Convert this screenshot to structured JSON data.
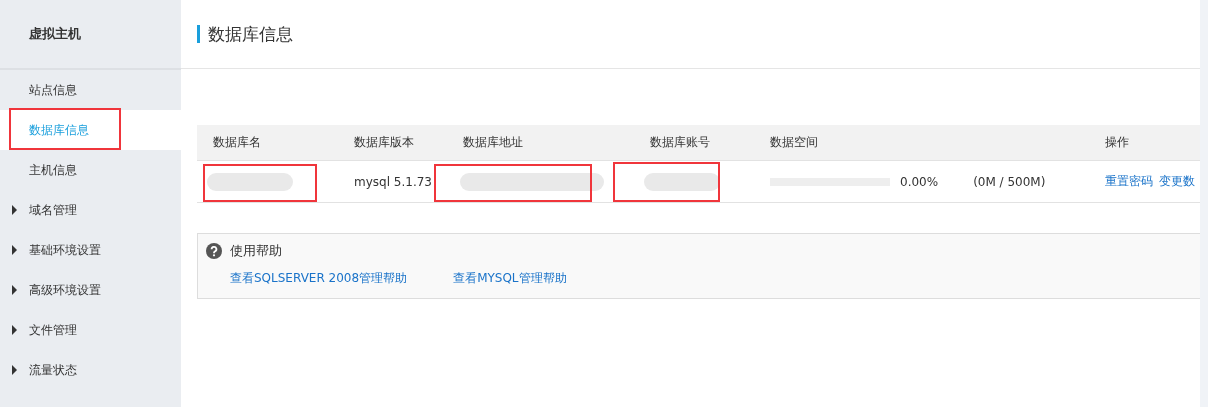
{
  "sidebar": {
    "title": "虚拟主机",
    "items": [
      {
        "label": "站点信息",
        "selected": false,
        "expandable": false,
        "highlighted": false
      },
      {
        "label": "数据库信息",
        "selected": true,
        "expandable": false,
        "highlighted": true
      },
      {
        "label": "主机信息",
        "selected": false,
        "expandable": false,
        "highlighted": false
      },
      {
        "label": "域名管理",
        "selected": false,
        "expandable": true,
        "highlighted": false
      },
      {
        "label": "基础环境设置",
        "selected": false,
        "expandable": true,
        "highlighted": false
      },
      {
        "label": "高级环境设置",
        "selected": false,
        "expandable": true,
        "highlighted": false
      },
      {
        "label": "文件管理",
        "selected": false,
        "expandable": true,
        "highlighted": false
      },
      {
        "label": "流量状态",
        "selected": false,
        "expandable": true,
        "highlighted": false
      }
    ]
  },
  "page_title": "数据库信息",
  "table": {
    "columns": [
      "数据库名",
      "数据库版本",
      "数据库地址",
      "数据库账号",
      "数据空间",
      "操作"
    ],
    "rows": [
      {
        "name": {
          "kind": "blurred",
          "highlighted": true
        },
        "version": {
          "kind": "text",
          "text": "mysql 5.1.73",
          "highlighted": false
        },
        "address": {
          "kind": "blurred",
          "highlighted": true
        },
        "account": {
          "kind": "blurred",
          "highlighted": true
        },
        "space": {
          "level": 0,
          "percent": "0.00%",
          "usage": "(0M / 500M)"
        },
        "actions": [
          "重置密码",
          "变更数"
        ]
      }
    ]
  },
  "help": {
    "title": "使用帮助",
    "links": [
      "查看SQLSERVER 2008管理帮助",
      "查看MYSQL管理帮助"
    ]
  }
}
